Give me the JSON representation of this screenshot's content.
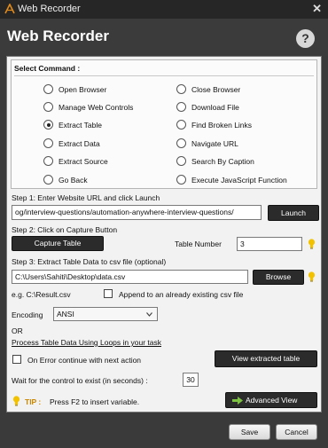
{
  "window": {
    "title": "Web Recorder",
    "close_glyph": "✕"
  },
  "header": {
    "title": "Web Recorder",
    "help_glyph": "?"
  },
  "commands": {
    "label": "Select Command :",
    "left": [
      {
        "label": "Open Browser",
        "selected": false
      },
      {
        "label": "Manage Web Controls",
        "selected": false
      },
      {
        "label": "Extract Table",
        "selected": true
      },
      {
        "label": "Extract Data",
        "selected": false
      },
      {
        "label": "Extract Source",
        "selected": false
      },
      {
        "label": "Go Back",
        "selected": false
      }
    ],
    "right": [
      {
        "label": "Close Browser",
        "selected": false
      },
      {
        "label": "Download File",
        "selected": false
      },
      {
        "label": "Find Broken Links",
        "selected": false
      },
      {
        "label": "Navigate URL",
        "selected": false
      },
      {
        "label": "Search By Caption",
        "selected": false
      },
      {
        "label": "Execute JavaScript Function",
        "selected": false
      }
    ]
  },
  "step1": {
    "label": "Step 1: Enter Website URL and click Launch",
    "url": "og/interview-questions/automation-anywhere-interview-questions/",
    "launch": "Launch"
  },
  "step2": {
    "label": "Step 2: Click on Capture Button",
    "capture": "Capture Table",
    "table_number_label": "Table Number",
    "table_number": "3"
  },
  "step3": {
    "label": "Step 3: Extract Table Data to csv file (optional)",
    "path": "C:\\Users\\Sahiti\\Desktop\\data.csv",
    "browse": "Browse",
    "example": "e.g. C:\\Result.csv",
    "append_label": "Append to an already existing csv file",
    "append_checked": false
  },
  "encoding": {
    "label": "Encoding",
    "value": "ANSI"
  },
  "or_text": "OR",
  "loop_link": "Process Table Data Using Loops in your task",
  "on_error": {
    "label": "On Error continue with next action",
    "checked": false
  },
  "view_extracted": "View extracted table",
  "wait": {
    "label": "Wait for the control to exist (in seconds) :",
    "value": "30"
  },
  "tip": {
    "label": "TIP :",
    "text": "Press F2 to insert variable."
  },
  "advanced_view": "Advanced View",
  "footer": {
    "save": "Save",
    "cancel": "Cancel"
  },
  "colors": {
    "bulb": "#f2c200",
    "advanced_arrow": "#7dc242"
  }
}
